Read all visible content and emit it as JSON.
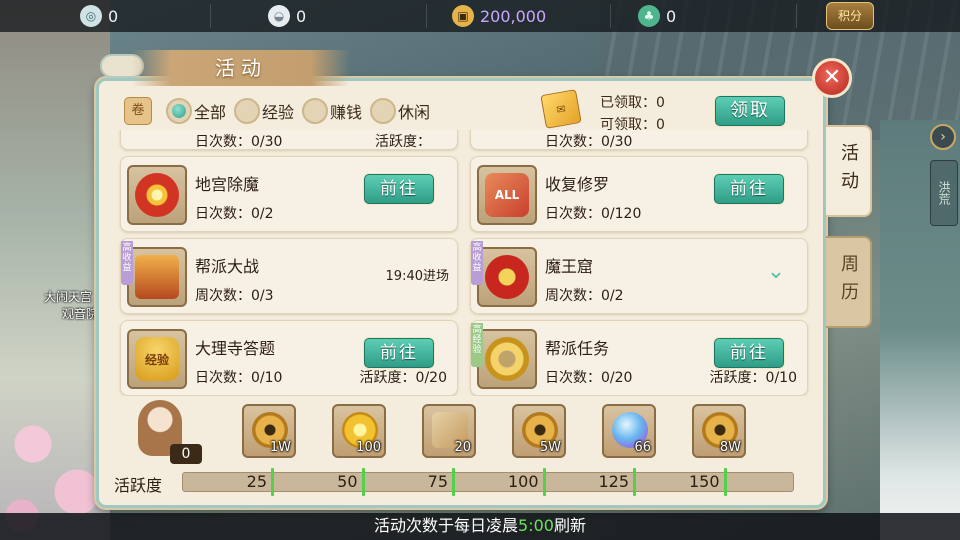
{
  "background": {
    "npc_labels": [
      "大闹天宫",
      "观音院"
    ],
    "right_tab": "洪荒"
  },
  "currencies": [
    {
      "icon": "jade-token-icon",
      "value": "0"
    },
    {
      "icon": "silver-ingot-icon",
      "value": "0"
    },
    {
      "icon": "copper-coin-icon",
      "value": "200,000",
      "color": "#c8a8ff"
    },
    {
      "icon": "green-gem-icon",
      "value": "0"
    }
  ],
  "score_button": "积分",
  "dialog": {
    "title": "活动",
    "filters": [
      {
        "label": "全部",
        "selected": true
      },
      {
        "label": "经验",
        "selected": false
      },
      {
        "label": "赚钱",
        "selected": false
      },
      {
        "label": "休闲",
        "selected": false
      }
    ],
    "claimed_label": "已领取：0",
    "claimable_label": "可领取：0",
    "claim_button": "领取",
    "side_tabs": [
      "活动",
      "周历"
    ],
    "peek_row": {
      "left_count": "日次数：0/30",
      "left_active": "活跃度：",
      "right_count": "日次数：0/30"
    },
    "activities": [
      {
        "name": "地宫除魔",
        "count": "日次数：0/2",
        "action": "前往",
        "art": "red-eye-icon"
      },
      {
        "name": "收复修罗",
        "count": "日次数：0/120",
        "action": "前往",
        "art": "all-scroll-icon",
        "art_text": "ALL"
      },
      {
        "name": "帮派大战",
        "count": "周次数：0/3",
        "time": "19:40进场",
        "badge": "高收益",
        "art": "pavilion-icon"
      },
      {
        "name": "魔王窟",
        "count": "周次数：0/2",
        "badge": "高收益",
        "art": "demon-king-icon",
        "expand": true
      },
      {
        "name": "大理寺答题",
        "count": "日次数：0/10",
        "active": "活跃度：0/20",
        "action": "前往",
        "art": "exp-gourd-icon",
        "art_text": "经验"
      },
      {
        "name": "帮派任务",
        "count": "日次数：0/20",
        "active": "活跃度：0/10",
        "action": "前往",
        "badge": "高经验",
        "art": "gold-ring-icon"
      }
    ],
    "mascot_count": "0",
    "rewards": [
      {
        "icon": "copper-coin-icon",
        "qty": "1W",
        "kind": "coin"
      },
      {
        "icon": "gold-flower-icon",
        "qty": "100",
        "kind": "flower"
      },
      {
        "icon": "scroll-icon",
        "qty": "20",
        "kind": "scroll"
      },
      {
        "icon": "copper-coin-icon",
        "qty": "5W",
        "kind": "coin"
      },
      {
        "icon": "spirit-orb-icon",
        "qty": "66",
        "kind": "orb"
      },
      {
        "icon": "copper-coin-icon",
        "qty": "8W",
        "kind": "coin"
      }
    ],
    "activity_label": "活跃度",
    "activity_value": 0,
    "milestones": [
      "25",
      "50",
      "75",
      "100",
      "125",
      "150"
    ]
  },
  "footer": {
    "prefix": "活动次数于每日凌晨",
    "time": "5:00",
    "suffix": "刷新"
  }
}
